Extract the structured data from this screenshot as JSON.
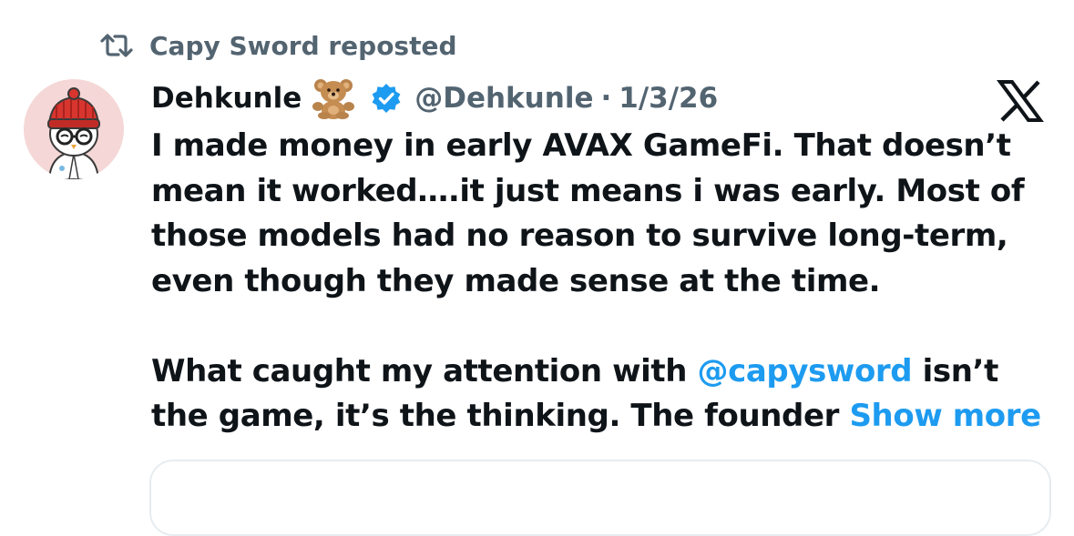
{
  "repost": {
    "icon": "repost-icon",
    "label": "Capy Sword reposted"
  },
  "author": {
    "display_name": "Dehkunle",
    "emoji": "🧸",
    "verified_icon": "verified-badge-icon",
    "handle": "@Dehkunle",
    "separator": "·",
    "date": "1/3/26"
  },
  "platform_logo": "x-logo-icon",
  "tweet": {
    "lines": [
      "I made money in early AVAX GameFi. That doesn’t",
      "mean it worked….it just means i was early. Most of",
      "those models had no reason to survive long-term,",
      "even though they made sense at the time."
    ],
    "para2_line1_before": "What caught my attention with ",
    "mention": "@capysword",
    "para2_line1_after": " isn’t",
    "para2_line2": "the game, it’s the thinking. The founder ",
    "show_more": "Show more"
  },
  "colors": {
    "text": "#0f1419",
    "muted": "#536471",
    "link": "#1d9bf0",
    "verified": "#1d9bf0"
  }
}
